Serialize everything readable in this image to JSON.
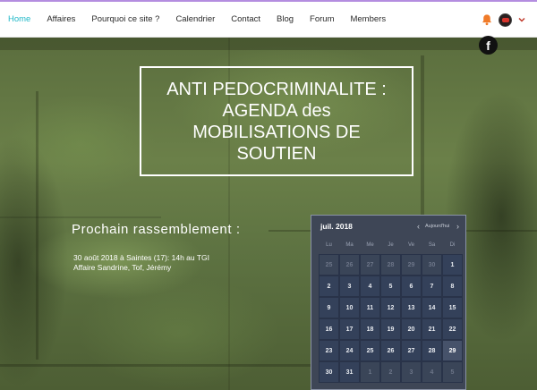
{
  "nav": {
    "items": [
      {
        "label": "Home",
        "active": true
      },
      {
        "label": "Affaires",
        "active": false
      },
      {
        "label": "Pourquoi ce site ?",
        "active": false
      },
      {
        "label": "Calendrier",
        "active": false
      },
      {
        "label": "Contact",
        "active": false
      },
      {
        "label": "Blog",
        "active": false
      },
      {
        "label": "Forum",
        "active": false
      },
      {
        "label": "Members",
        "active": false
      }
    ],
    "icons": [
      "bell-icon",
      "avatar",
      "chevron-down-icon"
    ],
    "active_color": "#20b8c8",
    "bell_color": "#f07b29"
  },
  "social": {
    "facebook_glyph": "f"
  },
  "hero": {
    "title": "ANTI PEDOCRIMINALITE : AGENDA des MOBILISATIONS DE SOUTIEN"
  },
  "event": {
    "heading": "Prochain rassemblement :",
    "line1": "30 août 2018 à Saintes (17): 14h au TGI",
    "line2": "Affaire Sandrine, Tof, Jérémy"
  },
  "calendar": {
    "month_label": "juil. 2018",
    "prev_glyph": "‹",
    "today_label": "Aujourd'hui",
    "next_glyph": "›",
    "weekdays": [
      "Lu",
      "Ma",
      "Me",
      "Je",
      "Ve",
      "Sa",
      "Di"
    ],
    "days": [
      {
        "d": "25",
        "other": true
      },
      {
        "d": "26",
        "other": true
      },
      {
        "d": "27",
        "other": true
      },
      {
        "d": "28",
        "other": true
      },
      {
        "d": "29",
        "other": true
      },
      {
        "d": "30",
        "other": true
      },
      {
        "d": "1",
        "other": false
      },
      {
        "d": "2",
        "other": false
      },
      {
        "d": "3",
        "other": false
      },
      {
        "d": "4",
        "other": false
      },
      {
        "d": "5",
        "other": false
      },
      {
        "d": "6",
        "other": false
      },
      {
        "d": "7",
        "other": false
      },
      {
        "d": "8",
        "other": false
      },
      {
        "d": "9",
        "other": false
      },
      {
        "d": "10",
        "other": false
      },
      {
        "d": "11",
        "other": false
      },
      {
        "d": "12",
        "other": false
      },
      {
        "d": "13",
        "other": false
      },
      {
        "d": "14",
        "other": false
      },
      {
        "d": "15",
        "other": false
      },
      {
        "d": "16",
        "other": false
      },
      {
        "d": "17",
        "other": false
      },
      {
        "d": "18",
        "other": false
      },
      {
        "d": "19",
        "other": false
      },
      {
        "d": "20",
        "other": false
      },
      {
        "d": "21",
        "other": false
      },
      {
        "d": "22",
        "other": false
      },
      {
        "d": "23",
        "other": false
      },
      {
        "d": "24",
        "other": false
      },
      {
        "d": "25",
        "other": false
      },
      {
        "d": "26",
        "other": false
      },
      {
        "d": "27",
        "other": false
      },
      {
        "d": "28",
        "other": false
      },
      {
        "d": "29",
        "other": false,
        "selected": true
      },
      {
        "d": "30",
        "other": false
      },
      {
        "d": "31",
        "other": false
      },
      {
        "d": "1",
        "other": true
      },
      {
        "d": "2",
        "other": true
      },
      {
        "d": "3",
        "other": true
      },
      {
        "d": "4",
        "other": true
      },
      {
        "d": "5",
        "other": true
      }
    ]
  }
}
